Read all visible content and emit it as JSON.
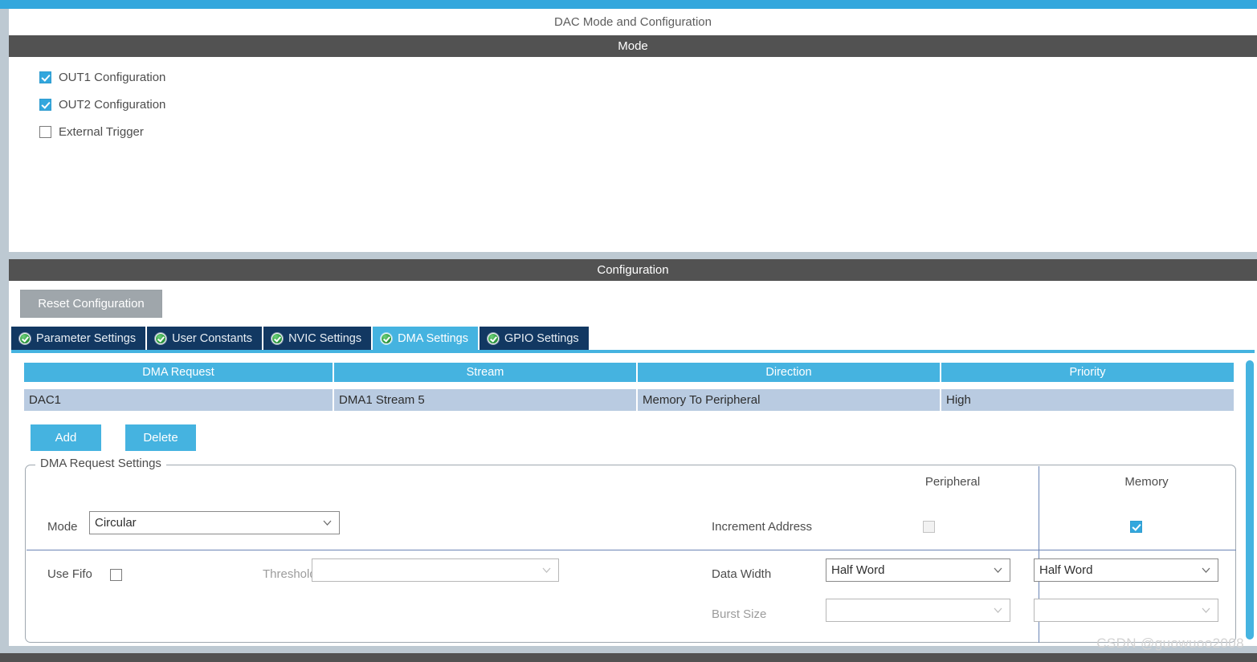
{
  "window": {
    "panel_title": "DAC Mode and Configuration"
  },
  "mode_section": {
    "header": "Mode",
    "options": [
      {
        "label": "OUT1 Configuration",
        "checked": true
      },
      {
        "label": "OUT2 Configuration",
        "checked": true
      },
      {
        "label": "External Trigger",
        "checked": false
      }
    ]
  },
  "configuration_section": {
    "header": "Configuration",
    "reset_button": "Reset Configuration",
    "tabs": [
      {
        "label": "Parameter Settings",
        "icon": "green-check-icon",
        "active": false
      },
      {
        "label": "User Constants",
        "icon": "green-check-icon",
        "active": false
      },
      {
        "label": "NVIC Settings",
        "icon": "green-check-icon",
        "active": false
      },
      {
        "label": "DMA Settings",
        "icon": "green-check-icon",
        "active": true
      },
      {
        "label": "GPIO Settings",
        "icon": "green-check-icon",
        "active": false
      }
    ],
    "dma_table": {
      "columns": [
        "DMA Request",
        "Stream",
        "Direction",
        "Priority"
      ],
      "rows": [
        {
          "dma_request": "DAC1",
          "stream": "DMA1 Stream 5",
          "direction": "Memory To Peripheral",
          "priority": "High"
        }
      ]
    },
    "actions": {
      "add": "Add",
      "delete": "Delete"
    },
    "request_settings": {
      "legend": "DMA Request Settings",
      "mode_label": "Mode",
      "mode_value": "Circular",
      "use_fifo_label": "Use Fifo",
      "use_fifo_checked": false,
      "threshold_label": "Threshold",
      "threshold_value": "",
      "column_headers": {
        "peripheral": "Peripheral",
        "memory": "Memory"
      },
      "rows": [
        {
          "label": "Increment Address",
          "type": "checkbox",
          "peripheral_checked": false,
          "memory_checked": true
        },
        {
          "label": "Data Width",
          "type": "combo",
          "peripheral_value": "Half Word",
          "memory_value": "Half Word",
          "disabled": false
        },
        {
          "label": "Burst Size",
          "type": "combo",
          "peripheral_value": "",
          "memory_value": "",
          "disabled": true
        }
      ]
    }
  },
  "watermark": "CSDN @guowuoo2008",
  "colors": {
    "accent_blue": "#45b3e0",
    "window_blue": "#33a7dd",
    "header_dark": "#525252",
    "tab_navy": "#123862",
    "row_selected": "#b9cbe1",
    "pale_strip": "#bdc9d2",
    "reset_gray": "#9fa6ab",
    "divider_blue": "#6b85b5"
  }
}
